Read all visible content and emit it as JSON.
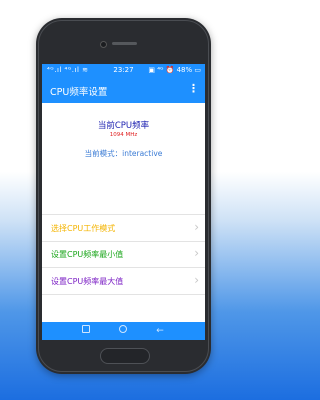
{
  "status_bar": {
    "left": "⁴ᴳ.ıl ⁴ᴳ.ıl ≋",
    "time": "23:27",
    "right": "▣ ⁴ᴳ ⏰ 48% ▭"
  },
  "app_bar": {
    "title": "CPU频率设置",
    "menu_label": "⋮"
  },
  "info": {
    "freq_label": "当前CPU频率",
    "freq_value": "1094 MHz",
    "mode_text": "当前模式：interactive"
  },
  "menu": {
    "items": [
      {
        "label": "选择CPU工作模式",
        "color": "#f4b400"
      },
      {
        "label": "设置CPU频率最小值",
        "color": "#19a519"
      },
      {
        "label": "设置CPU频率最大值",
        "color": "#7b1fc4"
      }
    ],
    "chevron": "›"
  },
  "navbar": {
    "back_glyph": "←"
  },
  "colors": {
    "accent": "#1e90ff",
    "freq_value": "#e02020",
    "mode_text": "#3a7bd5"
  }
}
